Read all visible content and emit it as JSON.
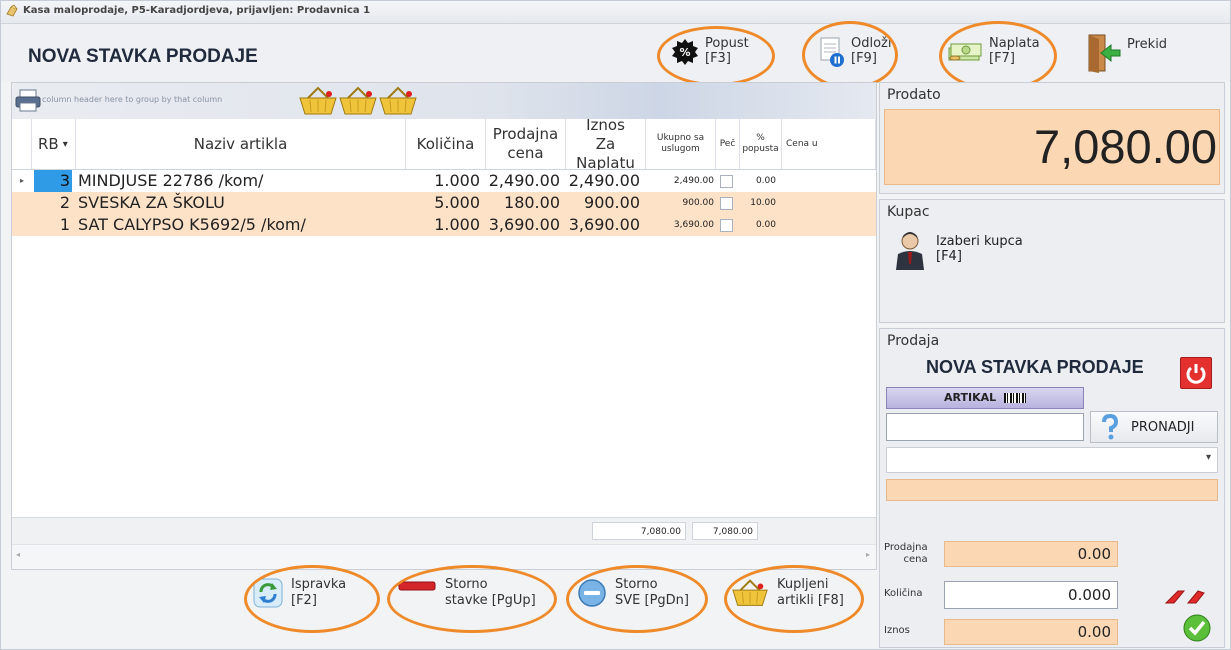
{
  "window": {
    "title": "Kasa maloprodaje, P5-Karadjordjeva, prijavljen: Prodavnica 1"
  },
  "toolbar": {
    "title": "NOVA STAVKA PRODAJE",
    "popust": "Popust\n[F3]",
    "odlozi": "Odloži\n[F9]",
    "naplata": "Naplata\n[F7]",
    "prekid": "Prekid"
  },
  "grid": {
    "group_hint": "column header here to group by that column",
    "headers": {
      "rb": "RB",
      "naziv": "Naziv artikla",
      "kolicina": "Količina",
      "cena": "Prodajna cena",
      "iznos": "Iznos Za Naplatu",
      "ukupno": "Ukupno sa uslugom",
      "pec": "Peč",
      "popusta": "% popusta",
      "cenau": "Cena u"
    },
    "rows": [
      {
        "rb": "3",
        "naziv": "MINDJUSE 22786 /kom/",
        "kolicina": "1.000",
        "cena": "2,490.00",
        "iznos": "2,490.00",
        "ukupno": "2,490.00",
        "popusta": "0.00"
      },
      {
        "rb": "2",
        "naziv": "SVESKA ZA ŠKOLU",
        "kolicina": "5.000",
        "cena": "180.00",
        "iznos": "900.00",
        "ukupno": "900.00",
        "popusta": "10.00"
      },
      {
        "rb": "1",
        "naziv": "SAT CALYPSO K5692/5 /kom/",
        "kolicina": "1.000",
        "cena": "3,690.00",
        "iznos": "3,690.00",
        "ukupno": "3,690.00",
        "popusta": "0.00"
      }
    ],
    "footer": {
      "iznos_total": "7,080.00",
      "ukupno_total": "7,080.00"
    }
  },
  "bottom": {
    "ispravka": "Ispravka\n[F2]",
    "storno_stavke": "Storno\nstavke [PgUp]",
    "storno_sve": "Storno\nSVE [PgDn]",
    "kupljeni": "Kupljeni\nartikli [F8]"
  },
  "right": {
    "prodato_title": "Prodato",
    "prodato_value": "7,080.00",
    "kupac_title": "Kupac",
    "izaberi_kupca": "Izaberi kupca\n[F4]",
    "prodaja_title": "Prodaja",
    "prodaja_heading": "NOVA STAVKA PRODAJE",
    "artikal_label": "ARTIKAL",
    "search_value": "",
    "pronadji": "PRONADJI",
    "prodajna_cena_label": "Prodajna\ncena",
    "prodajna_cena_value": "0.00",
    "kolicina_label": "Količina",
    "kolicina_value": "0.000",
    "iznos_label": "Iznos",
    "iznos_value": "0.00"
  },
  "colors": {
    "accent_orange": "#ef8a2a",
    "row_highlight": "#fde2c8",
    "selected_blue": "#2f9ae6"
  }
}
